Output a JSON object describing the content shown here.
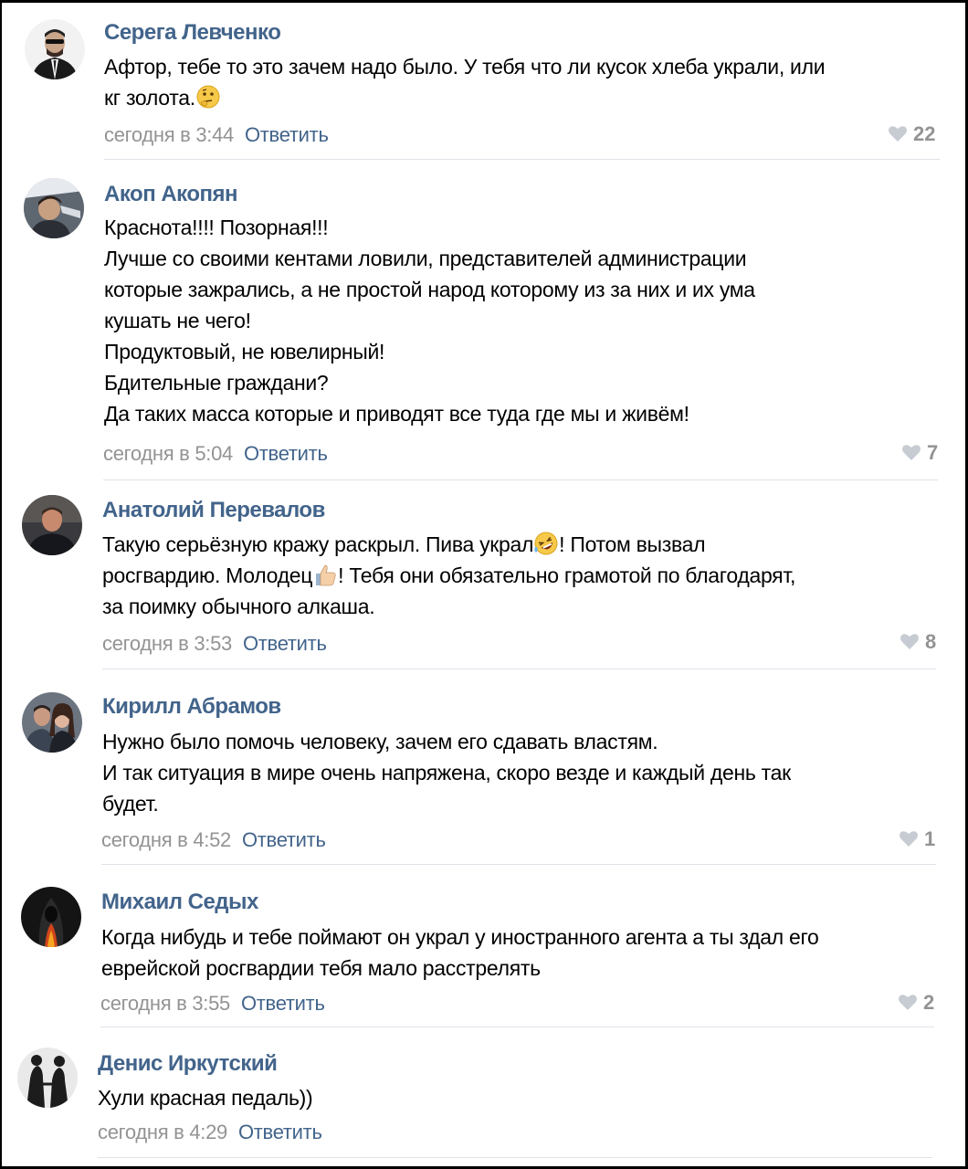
{
  "comments": [
    {
      "author": "Серега Левченко",
      "lines": [
        "Афтор, тебе то это зачем надо было. У тебя что ли кусок хлеба украли, или",
        "кг золота."
      ],
      "time": "сегодня в 3:44",
      "reply": "Ответить",
      "likes": "22",
      "avatar_icon": "man-in-suit-sunglasses-avatar",
      "emoji": "thinking-face-emoji"
    },
    {
      "author": "Акоп Акопян",
      "lines": [
        "Краснота!!!! Позорная!!!",
        "Лучше со своими кентами ловили, представителей администрации",
        "которые зажрались, а не простой народ которому из за них и их ума",
        "кушать не чего!",
        "Продуктовый, не ювелирный!",
        "Бдительные граждани?",
        "Да таких масса которые и приводят все туда где мы и живём!"
      ],
      "time": "сегодня в 5:04",
      "reply": "Ответить",
      "likes": "7",
      "avatar_icon": "man-in-car-avatar"
    },
    {
      "author": "Анатолий Перевалов",
      "lines_rich": [
        [
          "Такую серьёзную кражу раскрыл. Пива украл",
          "! Потом вызвал"
        ],
        [
          "росгвардию. Молодец",
          "! Тебя они обязательно грамотой по благодарят,"
        ],
        [
          "за поимку обычного алкаша."
        ]
      ],
      "time": "сегодня в 3:53",
      "reply": "Ответить",
      "likes": "8",
      "avatar_icon": "man-portrait-avatar",
      "emojis": [
        "rolling-laughing-emoji",
        "thumbs-up-emoji"
      ]
    },
    {
      "author": "Кирилл Абрамов",
      "lines": [
        "Нужно было помочь человеку, зачем его сдавать властям.",
        "И так ситуация в мире очень напряжена, скоро везде и каждый день так",
        "будет."
      ],
      "time": "сегодня в 4:52",
      "reply": "Ответить",
      "likes": "1",
      "avatar_icon": "couple-photo-avatar"
    },
    {
      "author": "Михаил Седых",
      "lines": [
        "Когда нибудь и тебе поймают он украл у иностранного агента а ты здал его",
        "еврейской росгвардии тебя мало расстрелять"
      ],
      "time": "сегодня в 3:55",
      "reply": "Ответить",
      "likes": "2",
      "avatar_icon": "hooded-figure-fire-avatar"
    },
    {
      "author": "Денис Иркутский",
      "lines": [
        "Хули красная педаль))"
      ],
      "time": "сегодня в 4:29",
      "reply": "Ответить",
      "likes": "",
      "avatar_icon": "silhouettes-avatar"
    }
  ],
  "colors": {
    "author": "#42648b",
    "meta": "#939393",
    "separator": "#dfe2e8",
    "background": "#ffffff"
  }
}
